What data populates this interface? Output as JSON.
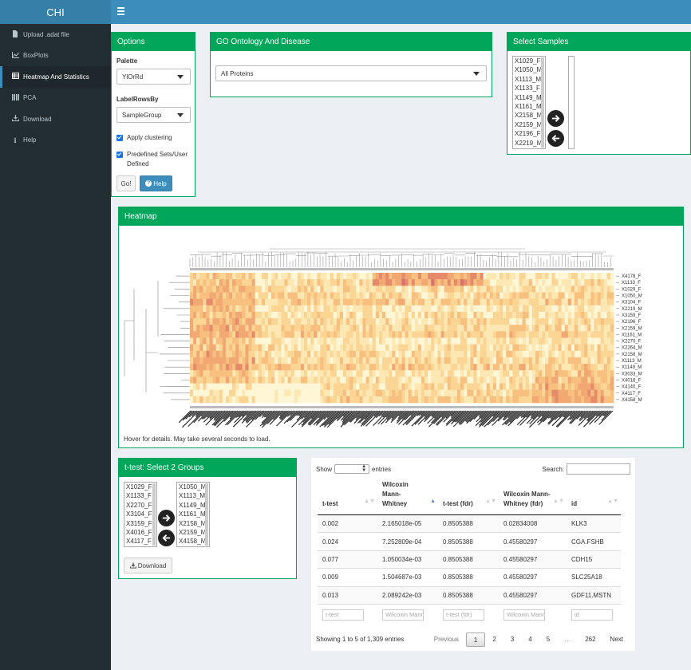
{
  "app": {
    "title": "CHI"
  },
  "sidebar": {
    "items": [
      {
        "label": "Upload .adat file",
        "icon": "file-icon"
      },
      {
        "label": "BoxPlots",
        "icon": "line-chart-icon"
      },
      {
        "label": "Heatmap And Statistics",
        "icon": "table-icon"
      },
      {
        "label": "PCA",
        "icon": "barcode-icon"
      },
      {
        "label": "Download",
        "icon": "download-icon"
      },
      {
        "label": "Help",
        "icon": "info-icon"
      }
    ]
  },
  "options": {
    "title": "Options",
    "palette_label": "Palette",
    "palette_value": "YlOrRd",
    "labelrows_label": "LabelRowsBy",
    "labelrows_value": "SampleGroup",
    "check1": "Apply clustering",
    "check2": "Predefined Sets/User Defined",
    "go_label": "Go!",
    "help_label": "Help"
  },
  "go": {
    "title": "GO Ontology And Disease",
    "value": "All Proteins"
  },
  "samples": {
    "title": "Select Samples",
    "list": [
      "X1029_F",
      "X1050_M",
      "X1113_M",
      "X1133_F",
      "X1149_M",
      "X1161_M",
      "X2158_M",
      "X2159_M",
      "X2196_F",
      "X2219_M"
    ]
  },
  "heatmap": {
    "title": "Heatmap",
    "row_labels": [
      "X4178_F",
      "X1133_F",
      "X1029_F",
      "X1050_M",
      "X3104_F",
      "X2219_M",
      "X3159_F",
      "X2196_F",
      "X2159_M",
      "X1161_M",
      "X2270_F",
      "X2264_M",
      "X2158_M",
      "X1113_M",
      "X1149_M",
      "X3033_M",
      "X4016_F",
      "X4140_F",
      "X4117_F",
      "X4158_M"
    ],
    "note": "Hover for details. May take several seconds to load."
  },
  "ttest": {
    "title": "t-test: Select 2 Groups",
    "left": [
      "X1029_F",
      "X1133_F",
      "X2270_F",
      "X3104_F",
      "X3159_F",
      "X4016_F",
      "X4117_F"
    ],
    "right": [
      "X1050_M",
      "X1113_M",
      "X1149_M",
      "X1161_M",
      "X2158_M",
      "X2159_M",
      "X4158_M"
    ],
    "download_label": "Download"
  },
  "table": {
    "show_label": "Show",
    "entries_label": "entries",
    "search_label": "Search:",
    "columns": [
      "t-test",
      "Wilcoxin Mann-Whitney",
      "t-test (fdr)",
      "Wilcoxin Mann-Whitney (fdr)",
      "id"
    ],
    "rows": [
      [
        "0.002",
        "2.165018e-05",
        "0.8505388",
        "0.02834008",
        "KLK3"
      ],
      [
        "0.024",
        "7.252809e-04",
        "0.8505388",
        "0.45580297",
        "CGA.FSHB"
      ],
      [
        "0.077",
        "1.050034e-03",
        "0.8505388",
        "0.45580297",
        "CDH15"
      ],
      [
        "0.009",
        "1.504687e-03",
        "0.8505388",
        "0.45580297",
        "SLC25A18"
      ],
      [
        "0.013",
        "2.089242e-03",
        "0.8505388",
        "0.45580297",
        "GDF11.MSTN"
      ]
    ],
    "filters": [
      "t-test",
      "Wilcoxin Mann-W",
      "t-test (fdr)",
      "Wilcoxin Mann-W",
      "id"
    ],
    "info": "Showing 1 to 5 of 1,309 entries",
    "pages": [
      "Previous",
      "1",
      "2",
      "3",
      "4",
      "5",
      "…",
      "262",
      "Next"
    ]
  },
  "colors": {
    "header": "#3c8dbc",
    "sidebar": "#222d32",
    "box": "#00a65a"
  }
}
